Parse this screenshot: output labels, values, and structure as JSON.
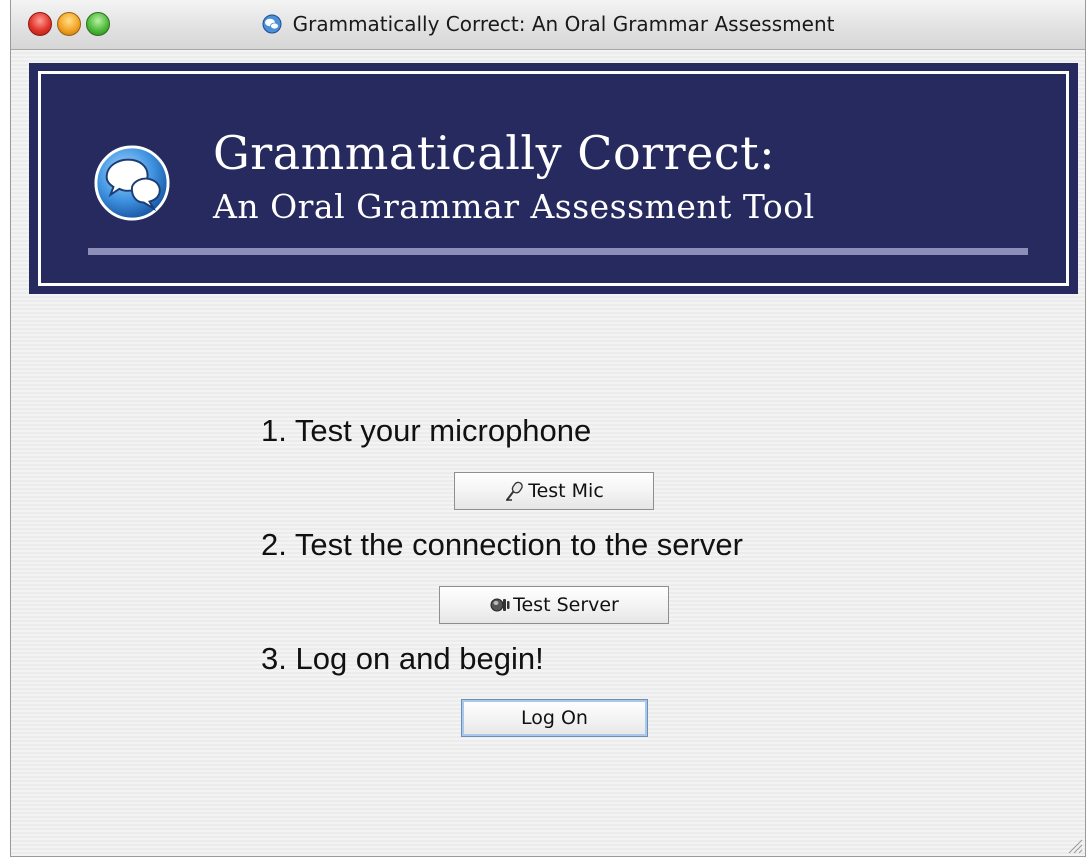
{
  "window": {
    "title": "Grammatically Correct: An Oral Grammar Assessment"
  },
  "banner": {
    "title": "Grammatically Correct:",
    "subtitle": "An Oral Grammar Assessment Tool",
    "background_color": "#262a5e",
    "rule_color": "#8e8fb8"
  },
  "steps": [
    {
      "label": "1. Test your microphone",
      "button_label": "Test Mic",
      "button_icon": "microphone-icon"
    },
    {
      "label": "2. Test the connection to the server",
      "button_label": "Test Server",
      "button_icon": "server-connection-icon"
    },
    {
      "label": "3. Log on and begin!",
      "button_label": "Log On"
    }
  ]
}
